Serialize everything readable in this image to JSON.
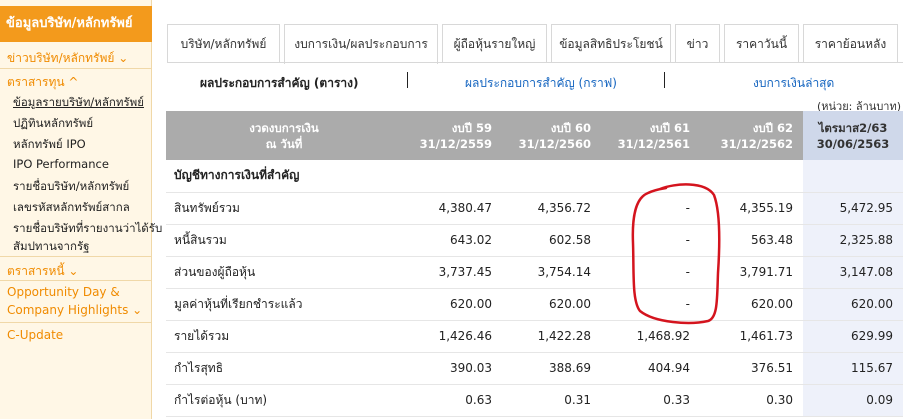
{
  "sidebar": {
    "header": "ข้อมูลบริษัท/หลักทรัพย์",
    "company_section": "ข่าวบริษัท/หลักทรัพย์ ⌄",
    "equity_section": "ตราสารทุน ^",
    "equity_items": [
      "ข้อมูลรายบริษัท/หลักทรัพย์",
      "ปฏิทินหลักทรัพย์",
      "หลักทรัพย์ IPO",
      "IPO Performance",
      "รายชื่อบริษัท/หลักทรัพย์",
      "เลขรหัสหลักทรัพย์สากล",
      "รายชื่อบริษัทที่รายงานว่าได้รับ",
      "สัมปทานจากรัฐ"
    ],
    "debt_section": "ตราสารหนี้ ⌄",
    "opportunity_line1": "Opportunity Day &",
    "opportunity_line2": "Company Highlights ⌄",
    "cupdate": "C-Update"
  },
  "tabs": [
    "บริษัท/หลักทรัพย์",
    "งบการเงิน/ผลประกอบการ",
    "ผู้ถือหุ้นรายใหญ่",
    "ข้อมูลสิทธิประโยชน์",
    "ข่าว",
    "ราคาวันนี้",
    "ราคาย้อนหลัง"
  ],
  "subnav": {
    "active": "ผลประกอบการสำคัญ (ตาราง)",
    "graph": "ผลประกอบการสำคัญ (กราฟ)",
    "latest": "งบการเงินล่าสุด"
  },
  "unit": "(หน่วย: ล้านบาท)",
  "table": {
    "header_col0_line1": "งวดงบการเงิน",
    "header_col0_line2": "ณ วันที่",
    "columns": [
      {
        "line1": "งบปี 59",
        "line2": "31/12/2559"
      },
      {
        "line1": "งบปี 60",
        "line2": "31/12/2560"
      },
      {
        "line1": "งบปี 61",
        "line2": "31/12/2561"
      },
      {
        "line1": "งบปี 62",
        "line2": "31/12/2562"
      },
      {
        "line1": "ไตรมาส2/63",
        "line2": "30/06/2563"
      }
    ],
    "section_title": "บัญชีทางการเงินที่สำคัญ",
    "rows": [
      {
        "label": "สินทรัพย์รวม",
        "values": [
          "4,380.47",
          "4,356.72",
          "-",
          "4,355.19",
          "5,472.95"
        ]
      },
      {
        "label": "หนี้สินรวม",
        "values": [
          "643.02",
          "602.58",
          "-",
          "563.48",
          "2,325.88"
        ]
      },
      {
        "label": "ส่วนของผู้ถือหุ้น",
        "values": [
          "3,737.45",
          "3,754.14",
          "-",
          "3,791.71",
          "3,147.08"
        ]
      },
      {
        "label": "มูลค่าหุ้นที่เรียกชำระแล้ว",
        "values": [
          "620.00",
          "620.00",
          "-",
          "620.00",
          "620.00"
        ]
      },
      {
        "label": "รายได้รวม",
        "values": [
          "1,426.46",
          "1,422.28",
          "1,468.92",
          "1,461.73",
          "629.99"
        ]
      },
      {
        "label": "กำไรสุทธิ",
        "values": [
          "390.03",
          "388.69",
          "404.94",
          "376.51",
          "115.67"
        ]
      },
      {
        "label": "กำไรต่อหุ้น (บาท)",
        "values": [
          "0.63",
          "0.31",
          "0.33",
          "0.30",
          "0.09"
        ]
      }
    ]
  },
  "colors": {
    "brand_orange": "#f39a1c",
    "header_gray": "#ababab",
    "latest_col": "#eef1fa",
    "annotation_red": "#d4141e",
    "link_blue": "#1565c0"
  }
}
